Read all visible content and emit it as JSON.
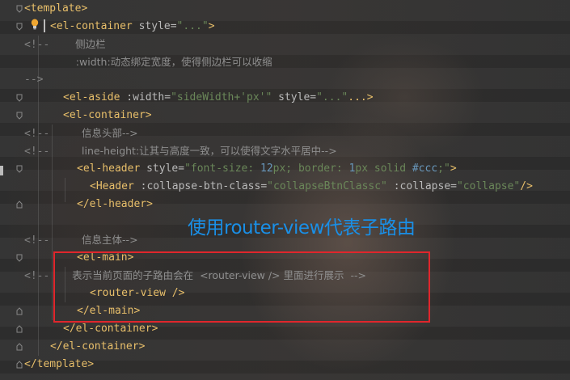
{
  "editor": {
    "lines": [
      {
        "id": "l1",
        "parts": [
          [
            "tag",
            "<template>"
          ]
        ]
      },
      {
        "id": "l2",
        "parts": [
          [
            "tag",
            "<el-container"
          ],
          [
            "attr",
            " style="
          ],
          [
            "str",
            "\"...\""
          ],
          [
            "tag",
            ">"
          ]
        ]
      },
      {
        "id": "l3",
        "parts": [
          [
            "cm",
            "<!--"
          ],
          [
            "cmt",
            "        侧边栏"
          ]
        ]
      },
      {
        "id": "l4",
        "parts": [
          [
            "cmt",
            "        :width:动态绑定宽度，使得侧边栏可以收缩"
          ]
        ]
      },
      {
        "id": "l5",
        "parts": [
          [
            "cm",
            "-->"
          ]
        ]
      },
      {
        "id": "l6",
        "parts": [
          [
            "tag",
            "<el-aside"
          ],
          [
            "attr",
            " :width="
          ],
          [
            "str",
            "\"sideWidth+'px'\""
          ],
          [
            "attr",
            " style="
          ],
          [
            "str",
            "\"...\""
          ],
          [
            "tag",
            "...>"
          ]
        ]
      },
      {
        "id": "l7",
        "parts": [
          [
            "tag",
            "<el-container>"
          ]
        ]
      },
      {
        "id": "l8",
        "parts": [
          [
            "cm",
            "<!--"
          ],
          [
            "cmt",
            "          信息头部-->"
          ]
        ]
      },
      {
        "id": "l9",
        "parts": [
          [
            "cm",
            "<!--"
          ],
          [
            "cmt",
            "          line-height:让其与高度一致，可以使得文字水平居中-->"
          ]
        ]
      },
      {
        "id": "l10",
        "parts": [
          [
            "tag",
            "<el-header"
          ],
          [
            "attr",
            " style="
          ],
          [
            "str",
            "\"font-size: "
          ],
          [
            "num",
            "12"
          ],
          [
            "str",
            "px; border: "
          ],
          [
            "num",
            "1"
          ],
          [
            "str",
            "px solid "
          ],
          [
            "num",
            "#ccc"
          ],
          [
            "str",
            ";\""
          ],
          [
            "tag",
            ">"
          ]
        ]
      },
      {
        "id": "l11",
        "parts": [
          [
            "tag",
            "<Header"
          ],
          [
            "attr",
            " :collapse-btn-class="
          ],
          [
            "str",
            "\"collapseBtnClassc\""
          ],
          [
            "attr",
            " :collapse="
          ],
          [
            "str",
            "\"collapse\""
          ],
          [
            "tag",
            "/>"
          ]
        ]
      },
      {
        "id": "l12",
        "parts": [
          [
            "tag",
            "</el-header>"
          ]
        ]
      },
      {
        "id": "l13",
        "parts": [
          [
            "cm",
            "<!--"
          ],
          [
            "cmt",
            "          信息主体-->"
          ]
        ]
      },
      {
        "id": "l14",
        "parts": [
          [
            "tag",
            "<el-main>"
          ]
        ]
      },
      {
        "id": "l15",
        "parts": [
          [
            "cm",
            "<!--"
          ],
          [
            "cmt",
            "       表示当前页面的子路由会在  <router-view /> 里面进行展示  -->"
          ]
        ]
      },
      {
        "id": "l16",
        "parts": [
          [
            "tag",
            "<router-view />"
          ]
        ]
      },
      {
        "id": "l17",
        "parts": [
          [
            "tag",
            "</el-main>"
          ]
        ]
      },
      {
        "id": "l18",
        "parts": [
          [
            "tag",
            "</el-container>"
          ]
        ]
      },
      {
        "id": "l19",
        "parts": [
          [
            "tag",
            "</el-container>"
          ]
        ]
      },
      {
        "id": "l20",
        "parts": [
          [
            "tag",
            "</template>"
          ]
        ]
      }
    ]
  },
  "annotation": {
    "text": "使用router-view代表子路由",
    "color": "#1a8fe6"
  },
  "highlight_box_color": "#e0262c",
  "icons": [
    "lightbulb-icon",
    "fold-marker-icon"
  ]
}
